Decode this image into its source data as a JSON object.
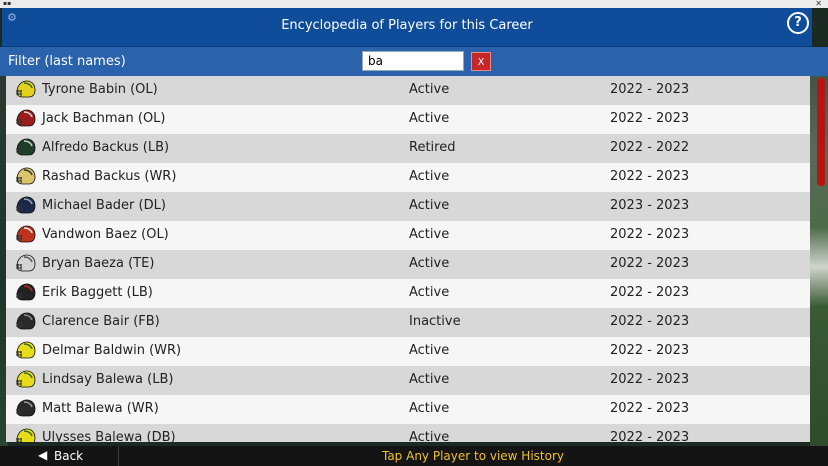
{
  "header": {
    "title": "Encyclopedia of Players for this Career",
    "help": "?"
  },
  "filter": {
    "label": "Filter (last names)",
    "value": "ba",
    "clear": "X"
  },
  "players": [
    {
      "name": "Tyrone Babin (OL)",
      "status": "Active",
      "years": "2022 - 2023",
      "helmet_color": "#e3d21c",
      "helmet_accent": "#2f6b2f"
    },
    {
      "name": "Jack Bachman (OL)",
      "status": "Active",
      "years": "2022 - 2023",
      "helmet_color": "#9c1c1c",
      "helmet_accent": "#d9d9d9"
    },
    {
      "name": "Alfredo Backus (LB)",
      "status": "Retired",
      "years": "2022 - 2022",
      "helmet_color": "#1f3d2a",
      "helmet_accent": "#cfcfcf"
    },
    {
      "name": "Rashad Backus (WR)",
      "status": "Active",
      "years": "2022 - 2023",
      "helmet_color": "#d8c46a",
      "helmet_accent": "#333333"
    },
    {
      "name": "Michael Bader (DL)",
      "status": "Active",
      "years": "2023 - 2023",
      "helmet_color": "#1c2a4a",
      "helmet_accent": "#9aa7bd"
    },
    {
      "name": "Vandwon Baez (OL)",
      "status": "Active",
      "years": "2022 - 2023",
      "helmet_color": "#c0321e",
      "helmet_accent": "#f2f2f2"
    },
    {
      "name": "Bryan Baeza (TE)",
      "status": "Active",
      "years": "2022 - 2023",
      "helmet_color": "#d4d4d4",
      "helmet_accent": "#555555"
    },
    {
      "name": "Erik Baggett (LB)",
      "status": "Active",
      "years": "2022 - 2023",
      "helmet_color": "#222222",
      "helmet_accent": "#c4261f"
    },
    {
      "name": "Clarence Bair (FB)",
      "status": "Inactive",
      "years": "2022 - 2023",
      "helmet_color": "#2a2a2a",
      "helmet_accent": "#8a8a8a"
    },
    {
      "name": "Delmar Baldwin (WR)",
      "status": "Active",
      "years": "2022 - 2023",
      "helmet_color": "#e6dc1a",
      "helmet_accent": "#2f6b2f"
    },
    {
      "name": "Lindsay Balewa (LB)",
      "status": "Active",
      "years": "2022 - 2023",
      "helmet_color": "#e6dc1a",
      "helmet_accent": "#2f6b2f"
    },
    {
      "name": "Matt Balewa (WR)",
      "status": "Active",
      "years": "2022 - 2023",
      "helmet_color": "#2a2a2a",
      "helmet_accent": "#9a9a9a"
    },
    {
      "name": "Ulysses Balewa (DB)",
      "status": "Active",
      "years": "2022 - 2023",
      "helmet_color": "#e6dc1a",
      "helmet_accent": "#2f6b2f"
    }
  ],
  "footer": {
    "back": "Back",
    "hint": "Tap Any Player to view History"
  },
  "colors": {
    "header": "#0f4d9a",
    "filter_bar": "#2a62ac",
    "clear_button": "#c62828",
    "scroll_thumb": "#b81414",
    "hint_text": "#f0c030"
  }
}
